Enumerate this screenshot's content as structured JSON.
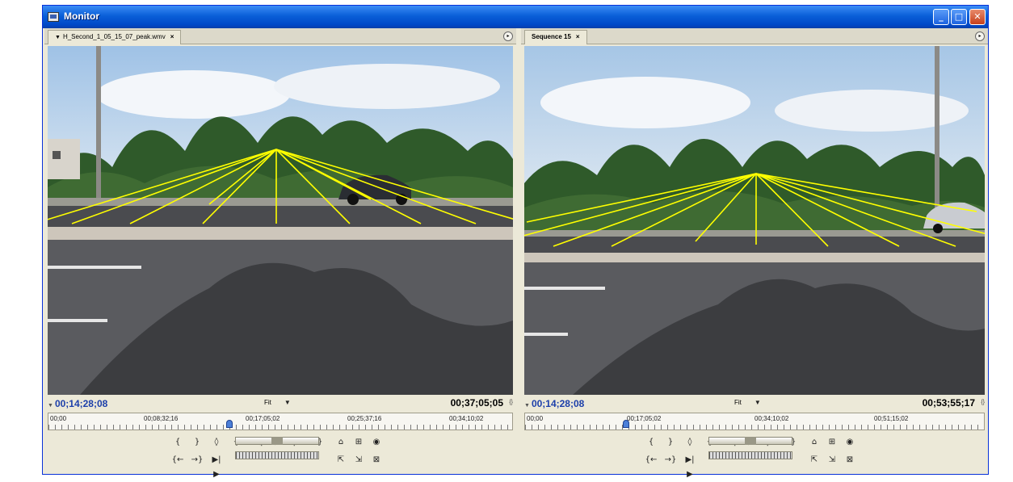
{
  "window": {
    "title": "Monitor",
    "minimize_icon": "minimize-icon",
    "maximize_icon": "maximize-icon",
    "close_icon": "close-icon"
  },
  "source": {
    "tab_label": "H_Second_1_05_15_07_peak.wmv",
    "tab_close": "×",
    "current_timecode": "00;14;28;08",
    "zoom": "Fit",
    "duration_timecode": "00;37;05;05",
    "ruler_labels": [
      "00;00",
      "00;08;32;16",
      "00;17;05;02",
      "00;25;37;16",
      "00;34;10;02"
    ],
    "playhead_fraction": 0.39
  },
  "program": {
    "tab_label": "Sequence 15",
    "tab_close": "×",
    "current_timecode": "00;14;28;08",
    "zoom": "Fit",
    "duration_timecode": "00;53;55;17",
    "ruler_labels": [
      "00;00",
      "00;17;05;02",
      "00;34;10;02",
      "00;51;15;02"
    ],
    "playhead_fraction": 0.22
  },
  "controls": {
    "row1": [
      "{",
      "}",
      "◊",
      "{←",
      "◀|",
      "▶",
      "|▶",
      "→}",
      "⌂",
      "⊞",
      "◉"
    ],
    "row2": [
      "{←",
      "→}",
      "▶|▶",
      "⇱",
      "⇲",
      "⊠"
    ]
  },
  "colors": {
    "timecode_blue": "#1c3faa",
    "titlebar": "#0a5fd8",
    "annotation_lines": "#ffff00"
  }
}
